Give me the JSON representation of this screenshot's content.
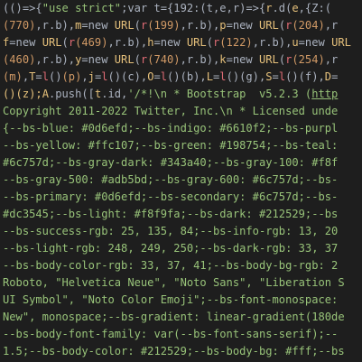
{
  "editor": {
    "lines": [
      [
        {
          "t": "(()=>{",
          "c": "th-white"
        },
        {
          "t": "\"use strict\"",
          "c": "th-green"
        },
        {
          "t": ";",
          "c": "th-white"
        },
        {
          "t": "var",
          "c": "th-white"
        },
        {
          "t": " t=",
          "c": "th-white"
        },
        {
          "t": "{192:(t,e,r)=>{",
          "c": "th-white"
        },
        {
          "t": "r",
          "c": "th-yellow"
        },
        {
          "t": ".d(",
          "c": "th-white"
        },
        {
          "t": "e",
          "c": "th-yellow"
        },
        {
          "t": ",{Z:(",
          "c": "th-white"
        }
      ],
      [
        {
          "t": "(770)",
          "c": "th-orange"
        },
        {
          "t": ",r.b),",
          "c": "th-white"
        },
        {
          "t": "m",
          "c": "th-yellow"
        },
        {
          "t": "=new ",
          "c": "th-white"
        },
        {
          "t": "URL",
          "c": "th-yellow"
        },
        {
          "t": "(",
          "c": "th-white"
        },
        {
          "t": "r",
          "c": "th-red"
        },
        {
          "t": "(199)",
          "c": "th-orange"
        },
        {
          "t": ",r.b),",
          "c": "th-white"
        },
        {
          "t": "p",
          "c": "th-yellow"
        },
        {
          "t": "=new ",
          "c": "th-white"
        },
        {
          "t": "URL",
          "c": "th-yellow"
        },
        {
          "t": "(",
          "c": "th-white"
        },
        {
          "t": "r",
          "c": "th-red"
        },
        {
          "t": "(204)",
          "c": "th-orange"
        },
        {
          "t": ",r",
          "c": "th-white"
        }
      ],
      [
        {
          "t": "f",
          "c": "th-yellow"
        },
        {
          "t": "=new ",
          "c": "th-white"
        },
        {
          "t": "URL",
          "c": "th-yellow"
        },
        {
          "t": "(",
          "c": "th-white"
        },
        {
          "t": "r",
          "c": "th-red"
        },
        {
          "t": "(469)",
          "c": "th-orange"
        },
        {
          "t": ",r.b),",
          "c": "th-white"
        },
        {
          "t": "h",
          "c": "th-yellow"
        },
        {
          "t": "=new ",
          "c": "th-white"
        },
        {
          "t": "URL",
          "c": "th-yellow"
        },
        {
          "t": "(",
          "c": "th-white"
        },
        {
          "t": "r",
          "c": "th-red"
        },
        {
          "t": "(122)",
          "c": "th-orange"
        },
        {
          "t": ",r.b),",
          "c": "th-white"
        },
        {
          "t": "u",
          "c": "th-yellow"
        },
        {
          "t": "=new ",
          "c": "th-white"
        },
        {
          "t": "URL",
          "c": "th-yellow"
        }
      ],
      [
        {
          "t": "(460)",
          "c": "th-orange"
        },
        {
          "t": ",r.b),",
          "c": "th-white"
        },
        {
          "t": "y",
          "c": "th-yellow"
        },
        {
          "t": "=new ",
          "c": "th-white"
        },
        {
          "t": "URL",
          "c": "th-yellow"
        },
        {
          "t": "(",
          "c": "th-white"
        },
        {
          "t": "r",
          "c": "th-red"
        },
        {
          "t": "(740)",
          "c": "th-orange"
        },
        {
          "t": ",r.b),",
          "c": "th-white"
        },
        {
          "t": "k",
          "c": "th-yellow"
        },
        {
          "t": "=new ",
          "c": "th-white"
        },
        {
          "t": "URL",
          "c": "th-yellow"
        },
        {
          "t": "(",
          "c": "th-white"
        },
        {
          "t": "r",
          "c": "th-red"
        },
        {
          "t": "(254)",
          "c": "th-orange"
        },
        {
          "t": ",r",
          "c": "th-white"
        }
      ],
      [
        {
          "t": "(m)",
          "c": "th-orange"
        },
        {
          "t": ",",
          "c": "th-white"
        },
        {
          "t": "T",
          "c": "th-yellow"
        },
        {
          "t": "=",
          "c": "th-white"
        },
        {
          "t": "l",
          "c": "th-red"
        },
        {
          "t": "()",
          "c": "th-white"
        },
        {
          "t": "(p)",
          "c": "th-orange"
        },
        {
          "t": ",",
          "c": "th-white"
        },
        {
          "t": "j",
          "c": "th-yellow"
        },
        {
          "t": "=",
          "c": "th-white"
        },
        {
          "t": "l",
          "c": "th-red"
        },
        {
          "t": "()(c),",
          "c": "th-white"
        },
        {
          "t": "O",
          "c": "th-yellow"
        },
        {
          "t": "=",
          "c": "th-white"
        },
        {
          "t": "l",
          "c": "th-red"
        },
        {
          "t": "()(b),",
          "c": "th-white"
        },
        {
          "t": "L",
          "c": "th-yellow"
        },
        {
          "t": "=",
          "c": "th-white"
        },
        {
          "t": "l",
          "c": "th-red"
        },
        {
          "t": "()(g),",
          "c": "th-white"
        },
        {
          "t": "S",
          "c": "th-yellow"
        },
        {
          "t": "=",
          "c": "th-white"
        },
        {
          "t": "l",
          "c": "th-red"
        },
        {
          "t": "()(f),",
          "c": "th-white"
        },
        {
          "t": "D",
          "c": "th-yellow"
        },
        {
          "t": "=",
          "c": "th-white"
        }
      ],
      [
        {
          "t": "()(z);",
          "c": "th-yellow"
        },
        {
          "t": "A",
          "c": "th-yellow"
        },
        {
          "t": ".push([",
          "c": "th-white"
        },
        {
          "t": "t",
          "c": "th-yellow"
        },
        {
          "t": ".id,",
          "c": "th-white"
        },
        {
          "t": "'/*!\\n * Bootstrap  v5.2.3 (",
          "c": "th-green"
        },
        {
          "t": "http",
          "c": "th-green ul"
        }
      ],
      [
        {
          "t": "Copyright 2011-2022 Twitter, Inc.\\n * Licensed unde",
          "c": "th-green"
        }
      ],
      [
        {
          "t": "{--bs-blue: #0d6efd;--bs-indigo: #6610f2;--bs-purpl",
          "c": "th-green"
        }
      ],
      [
        {
          "t": "--bs-yellow: #ffc107;--bs-green: #198754;--bs-teal:",
          "c": "th-green"
        }
      ],
      [
        {
          "t": "#6c757d;--bs-gray-dark: #343a40;--bs-gray-100: #f8f",
          "c": "th-green"
        }
      ],
      [
        {
          "t": "--bs-gray-500: #adb5bd;--bs-gray-600: #6c757d;--bs-",
          "c": "th-green"
        }
      ],
      [
        {
          "t": "--bs-primary: #0d6efd;--bs-secondary: #6c757d;--bs-",
          "c": "th-green"
        }
      ],
      [
        {
          "t": "#dc3545;--bs-light: #f8f9fa;--bs-dark: #212529;--bs",
          "c": "th-green"
        }
      ],
      [
        {
          "t": "--bs-success-rgb: 25, 135, 84;--bs-info-rgb: 13, 20",
          "c": "th-green"
        }
      ],
      [
        {
          "t": "--bs-light-rgb: 248, 249, 250;--bs-dark-rgb: 33, 37",
          "c": "th-green"
        }
      ],
      [
        {
          "t": "--bs-body-color-rgb: 33, 37, 41;--bs-body-bg-rgb: 2",
          "c": "th-green"
        }
      ],
      [
        {
          "t": "Roboto, \"Helvetica Neue\", \"Noto Sans\", \"Liberation S",
          "c": "th-green"
        }
      ],
      [
        {
          "t": "UI Symbol\", \"Noto Color Emoji\";--bs-font-monospace:",
          "c": "th-green"
        }
      ],
      [
        {
          "t": "New\", monospace;--bs-gradient: linear-gradient(180de",
          "c": "th-green"
        }
      ],
      [
        {
          "t": "--bs-body-font-family: var(--bs-font-sans-serif);--",
          "c": "th-green"
        }
      ],
      [
        {
          "t": "1.5;--bs-body-color: #212529;--bs-body-bg: #fff;--bs",
          "c": "th-green"
        }
      ]
    ]
  }
}
